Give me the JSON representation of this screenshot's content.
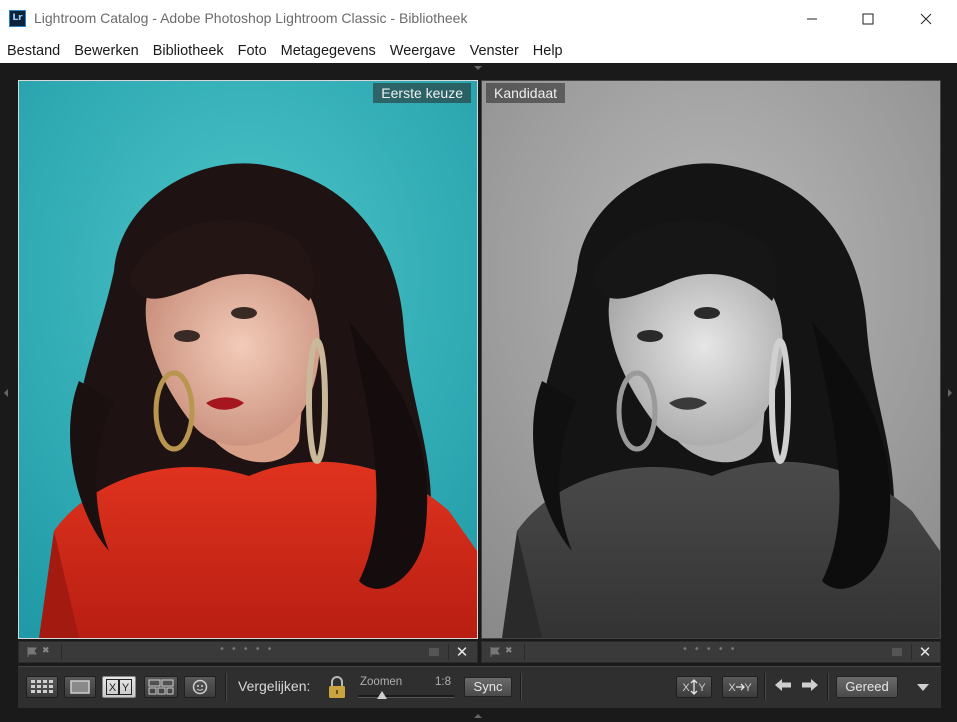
{
  "window": {
    "title": "Lightroom Catalog - Adobe Photoshop Lightroom Classic - Bibliotheek",
    "app_icon_label": "Lr"
  },
  "menu": [
    "Bestand",
    "Bewerken",
    "Bibliotheek",
    "Foto",
    "Metagegevens",
    "Weergave",
    "Venster",
    "Help"
  ],
  "compare": {
    "select_label": "Eerste keuze",
    "candidate_label": "Kandidaat"
  },
  "toolbar": {
    "compare_label": "Vergelijken:",
    "zoom_label": "Zoomen",
    "zoom_value": "1:8",
    "zoom_level": 0.25,
    "sync_label": "Sync",
    "done_label": "Gereed",
    "xy_label": "XY"
  },
  "icons": {
    "window_controls": [
      "minimize-icon",
      "maximize-icon",
      "close-icon"
    ],
    "views": [
      "grid-view-icon",
      "loupe-view-icon",
      "compare-view-icon",
      "survey-view-icon",
      "people-view-icon"
    ]
  },
  "colors": {
    "teal_background": "#2fb0b8",
    "sweater_red": "#d92b1c",
    "app_dark": "#1a1a1a"
  }
}
